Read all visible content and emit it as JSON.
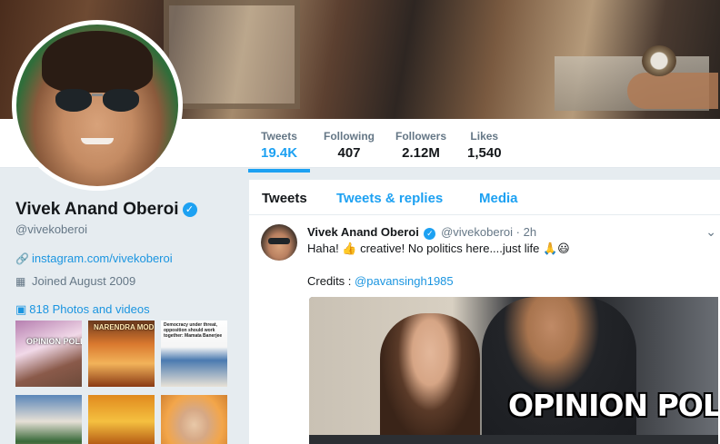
{
  "profile": {
    "name": "Vivek Anand Oberoi",
    "handle": "@vivekoberoi",
    "website": "instagram.com/vivekoberoi",
    "joined": "Joined August 2009",
    "photos_label": "818 Photos and videos",
    "verified_icon": "verified-badge-icon"
  },
  "stats": [
    {
      "label": "Tweets",
      "value": "19.4K"
    },
    {
      "label": "Following",
      "value": "407"
    },
    {
      "label": "Followers",
      "value": "2.12M"
    },
    {
      "label": "Likes",
      "value": "1,540"
    }
  ],
  "tabs": [
    "Tweets",
    "Tweets & replies",
    "Media"
  ],
  "thumbnails": [
    {
      "caption": "OPINION POLL"
    },
    {
      "caption": "NARENDRA MODI"
    },
    {
      "caption": "Democracy under threat, opposition should work together: Mamata Banerjee"
    },
    {
      "caption": ""
    },
    {
      "caption": ""
    },
    {
      "caption": ""
    }
  ],
  "tweet": {
    "name": "Vivek Anand Oberoi",
    "handle": "@vivekoberoi",
    "separator": "·",
    "time": "2h",
    "text": "Haha! 👍 creative! No politics here....just life 🙏😃",
    "credits_label": "Credits :",
    "credits_handle": "@pavansingh1985",
    "media_overlay": "OPINION POLL",
    "caret_icon": "chevron-down-icon"
  },
  "colors": {
    "accent": "#1da1f2",
    "link": "#1b95e0",
    "background": "#e6ecf0",
    "text": "#14171a",
    "muted": "#657786"
  }
}
